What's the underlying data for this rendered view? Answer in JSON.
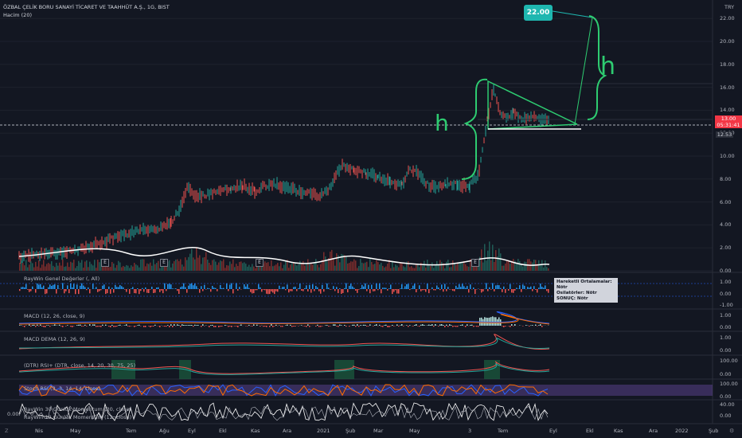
{
  "header": {
    "title": "ÖZBAL ÇELİK BORU SANAYİ TİCARET VE TAAHHÜT A.Ş., 1G, BIST",
    "volume_label": "Hacim (20)"
  },
  "currency": "TRY",
  "price_axis": [
    "22.00",
    "20.00",
    "18.00",
    "16.00",
    "14.00",
    "12.00",
    "10.00",
    "8.00",
    "6.00",
    "4.00",
    "2.00",
    "0.00"
  ],
  "current_price": {
    "value": "13.00",
    "countdown": "05:31:41"
  },
  "level_label": "12.53",
  "target_label": "22.00",
  "drawing_texts": {
    "left_letter": "h",
    "right_letter": "h"
  },
  "events": [
    "E",
    "E",
    "E",
    "E"
  ],
  "panes": [
    {
      "label": "RayWin Genel Değerler (, All)",
      "axis": [
        "1.00",
        "0.00",
        "-1.00"
      ]
    },
    {
      "label": "MACD (12, 26, close, 9)",
      "axis": [
        "1.00",
        "0.00"
      ]
    },
    {
      "label": "MACD DEMA (12, 26, 9)",
      "axis": [
        "1.00",
        "0.00"
      ]
    },
    {
      "label": "(DTR) RSI+ (DTR, close, 14, 20, 30, 75, 25)",
      "axis": [
        "100.00",
        "0.00"
      ]
    },
    {
      "label": "Stoch RSI (3, 3, 14, 14, close)",
      "axis": [
        "100.00",
        "0.00"
      ]
    },
    {
      "label": "RayWin 30 Günlük Momentum (30, close)",
      "axis": [
        "40.00",
        "0.00"
      ]
    },
    {
      "label": "RayWin 12 Günlük Momentum (12, close)",
      "axis": []
    }
  ],
  "left_value": "0.00",
  "tooltip": {
    "line1_key": "Hareketli Ortalamalar:",
    "line1_val": "Nötr",
    "line2_key": "Osilatörler:",
    "line2_val": "Nötr",
    "line3_key": "SONUÇ:",
    "line3_val": "Nötr"
  },
  "time_axis": [
    "Nis",
    "May",
    "Tem",
    "Ağu",
    "Eyl",
    "Ekl",
    "Kas",
    "Ara",
    "2021",
    "Şub",
    "Mar",
    "May",
    "3",
    "Tem",
    "Eyl",
    "Ekl",
    "Kas",
    "Ara",
    "2022",
    "Şub"
  ],
  "corner_icon": "z-icon",
  "colors": {
    "up": "#26a69a",
    "down": "#ef5350",
    "drawing": "#2ecc71",
    "volume_ma": "#ffffff",
    "target": "#1fb7b0",
    "stoch_fill": "#7e57c2"
  }
}
